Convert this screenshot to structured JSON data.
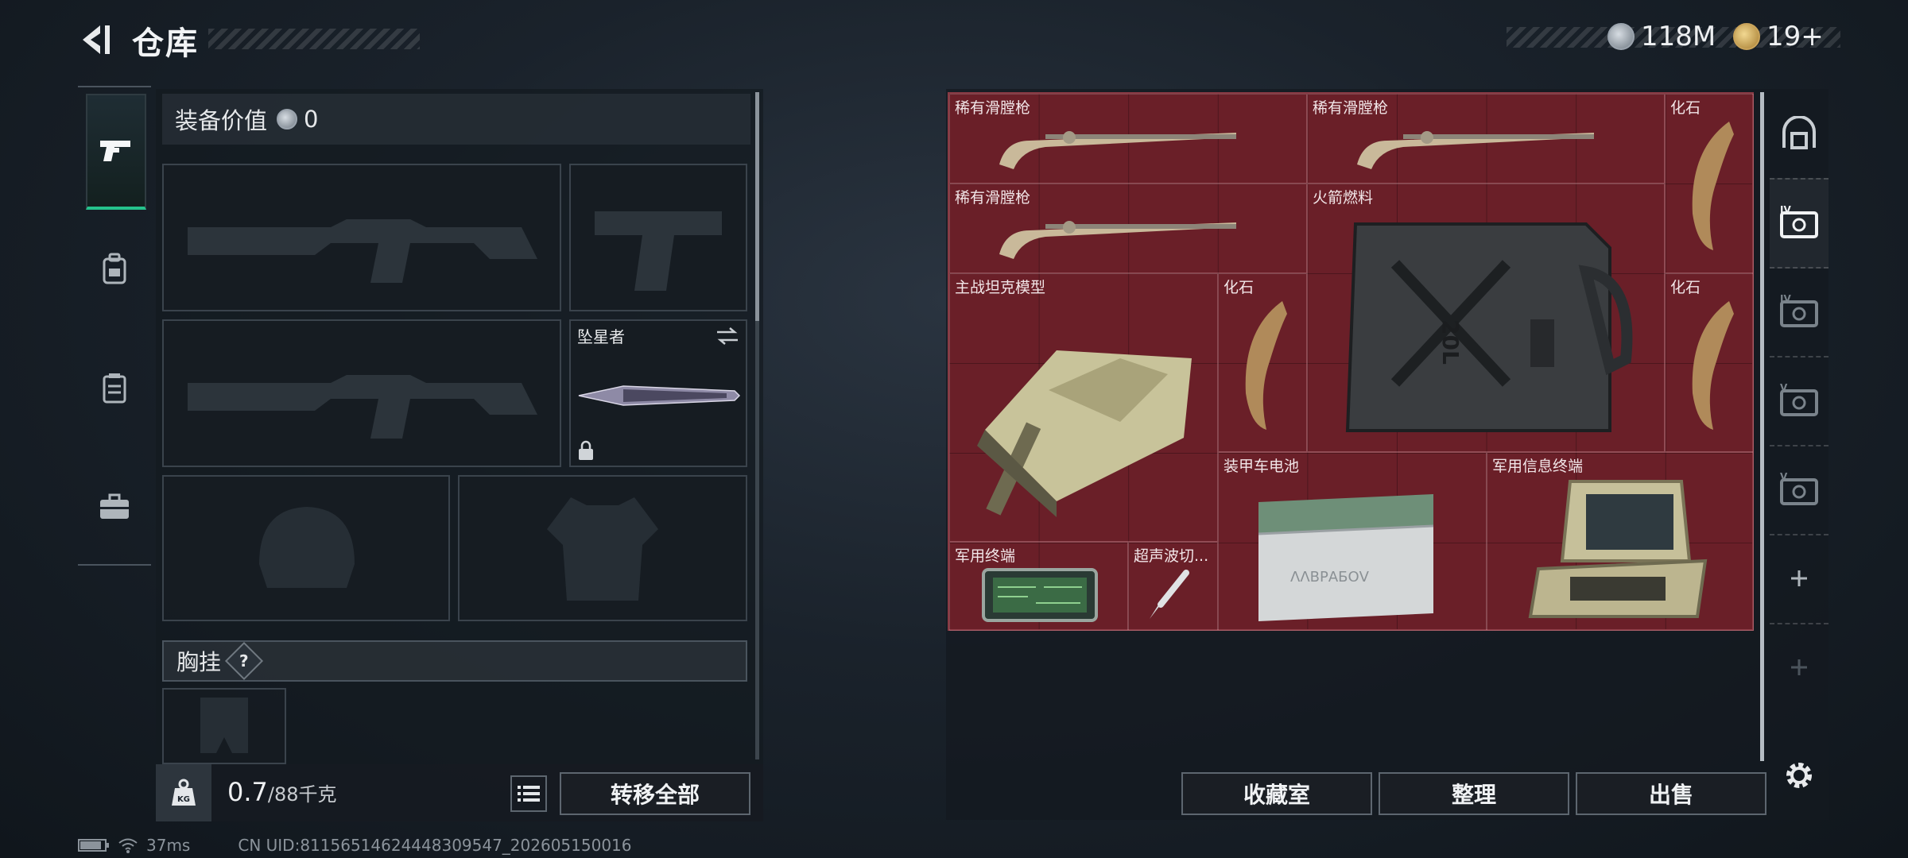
{
  "header": {
    "title": "仓库",
    "currency_silver": "118M",
    "currency_gold": "19+"
  },
  "loadout": {
    "value_label": "装备价值",
    "value_amount": "0",
    "melee_name": "坠星者",
    "chest_label": "胸挂",
    "chest_help": "?",
    "weight_current": "0.7",
    "weight_max": "/88千克",
    "weight_icon_text": "KG",
    "transfer_all_label": "转移全部"
  },
  "storage": {
    "items": [
      {
        "label": "稀有滑膛枪"
      },
      {
        "label": "稀有滑膛枪"
      },
      {
        "label": "化石"
      },
      {
        "label": "稀有滑膛枪"
      },
      {
        "label": "火箭燃料"
      },
      {
        "label": "主战坦克模型"
      },
      {
        "label": "化石"
      },
      {
        "label": "化石"
      },
      {
        "label": "装甲车电池"
      },
      {
        "label": "军用信息终端"
      },
      {
        "label": "军用终端"
      },
      {
        "label": "超声波切..."
      }
    ],
    "jerrycan_text": "20L",
    "battery_text": "ΛΛΒΡΑБΟV",
    "grid_color": "#6a1f28",
    "buttons": {
      "collection": "收藏室",
      "organize": "整理",
      "sell": "出售"
    },
    "side_tabs": [
      "IV",
      "IV",
      "V",
      "V"
    ]
  },
  "status": {
    "ping": "37ms",
    "uid": "CN UID:8115651462444830954​7_202605150016"
  },
  "colors": {
    "accent": "#25c28c",
    "slot_border": "#3a434c"
  }
}
